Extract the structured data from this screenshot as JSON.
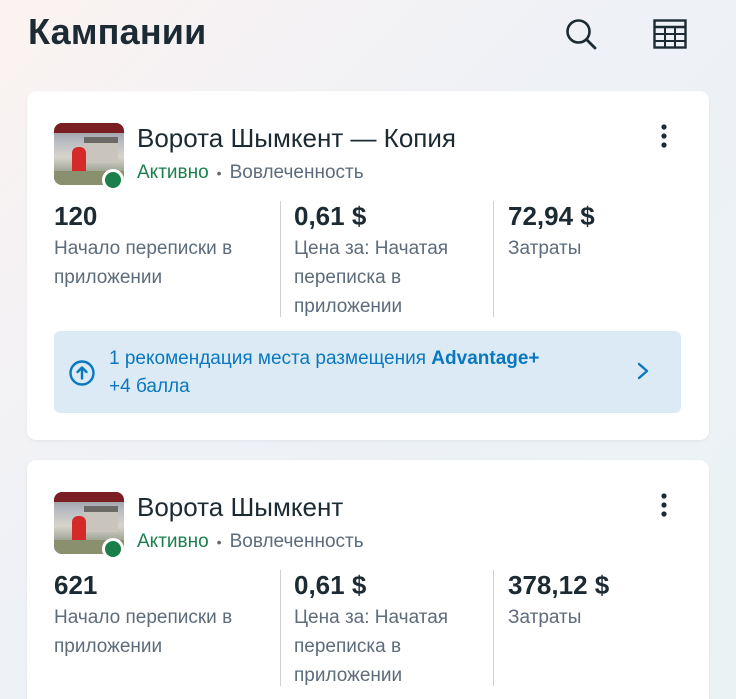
{
  "header": {
    "title": "Кампании",
    "icons": [
      "search-icon",
      "table-icon"
    ]
  },
  "colors": {
    "active_green": "#1a7f4b",
    "link_blue": "#0a78be",
    "reco_bg": "#dbeaf5",
    "text_dark": "#1c2b33",
    "text_muted": "#5d6c7b"
  },
  "campaigns": [
    {
      "name": "Ворота Шымкент — Копия",
      "status": "Активно",
      "separator": "•",
      "objective": "Вовлеченность",
      "metrics": [
        {
          "value": "120",
          "label": "Начало переписки в приложении"
        },
        {
          "value": "0,61 $",
          "label": "Цена за: Начатая переписка в приложении"
        },
        {
          "value": "72,94 $",
          "label": "Затраты"
        }
      ],
      "recommendation": {
        "line1_prefix": "1 рекомендация места размещения ",
        "line1_strong": "Advantage+",
        "line2": "+4 балла"
      }
    },
    {
      "name": "Ворота Шымкент",
      "status": "Активно",
      "separator": "•",
      "objective": "Вовлеченность",
      "metrics": [
        {
          "value": "621",
          "label": "Начало переписки в приложении"
        },
        {
          "value": "0,61 $",
          "label": "Цена за: Начатая переписка в приложении"
        },
        {
          "value": "378,12 $",
          "label": "Затраты"
        }
      ]
    }
  ]
}
